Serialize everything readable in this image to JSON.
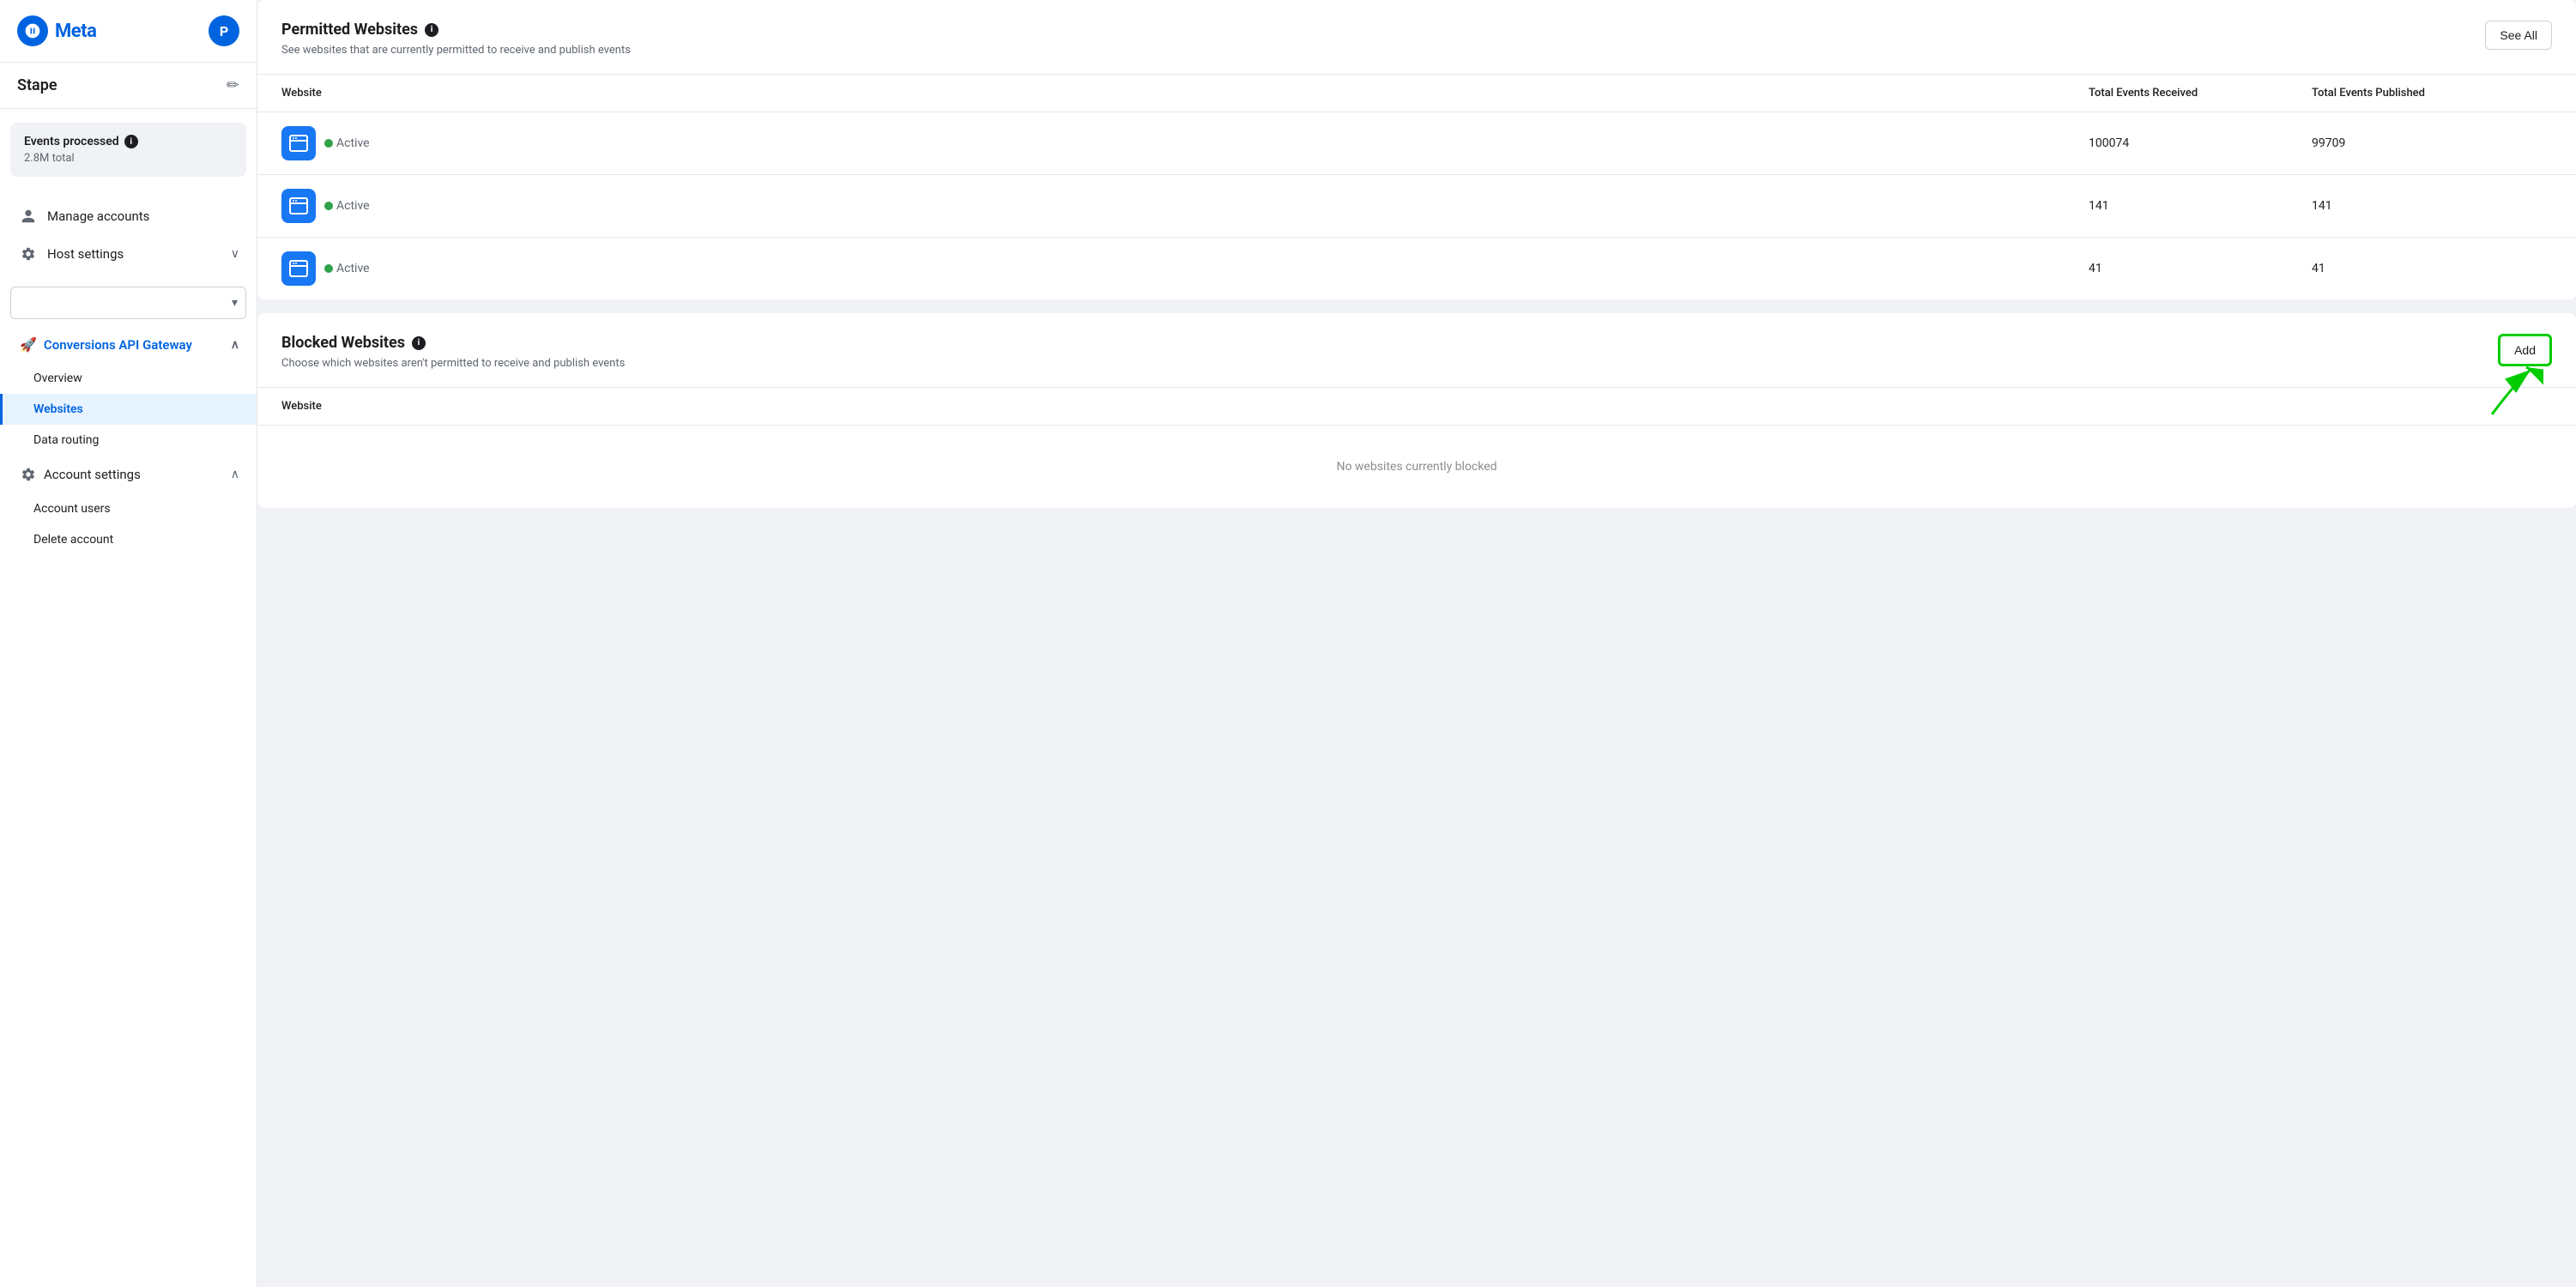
{
  "sidebar": {
    "logo": {
      "wordmark": "Meta"
    },
    "user_avatar": "P",
    "brand": {
      "name": "Stape",
      "edit_label": "✏"
    },
    "events_processed": {
      "title": "Events processed",
      "count": "2.8M total"
    },
    "nav_items": [
      {
        "id": "manage-accounts",
        "label": "Manage accounts",
        "icon": "person"
      },
      {
        "id": "host-settings",
        "label": "Host settings",
        "icon": "gear",
        "expandable": true
      }
    ],
    "api_gateway": {
      "label": "Conversions API Gateway",
      "icon": "🚀",
      "expanded": true
    },
    "sub_nav": [
      {
        "id": "overview",
        "label": "Overview",
        "active": false
      },
      {
        "id": "websites",
        "label": "Websites",
        "active": true
      },
      {
        "id": "data-routing",
        "label": "Data routing",
        "active": false
      }
    ],
    "account_settings": {
      "label": "Account settings",
      "expanded": true
    },
    "account_sub_nav": [
      {
        "id": "account-users",
        "label": "Account users",
        "active": false
      },
      {
        "id": "delete-account",
        "label": "Delete account",
        "active": false
      }
    ]
  },
  "permitted_websites": {
    "title": "Permitted Websites",
    "description": "See websites that are currently permitted to receive and publish events",
    "see_all_label": "See All",
    "columns": {
      "website": "Website",
      "total_received": "Total Events Received",
      "total_published": "Total Events Published"
    },
    "rows": [
      {
        "status": "Active",
        "events_received": "100074",
        "events_published": "99709"
      },
      {
        "status": "Active",
        "events_received": "141",
        "events_published": "141"
      },
      {
        "status": "Active",
        "events_received": "41",
        "events_published": "41"
      }
    ]
  },
  "blocked_websites": {
    "title": "Blocked Websites",
    "description": "Choose which websites aren't permitted to receive and publish events",
    "add_label": "Add",
    "columns": {
      "website": "Website"
    },
    "empty_state": "No websites currently blocked"
  },
  "colors": {
    "blue": "#1877f2",
    "green": "#31a24c",
    "active_border": "#00cc00",
    "text_primary": "#1c1e21",
    "text_secondary": "#606770"
  }
}
